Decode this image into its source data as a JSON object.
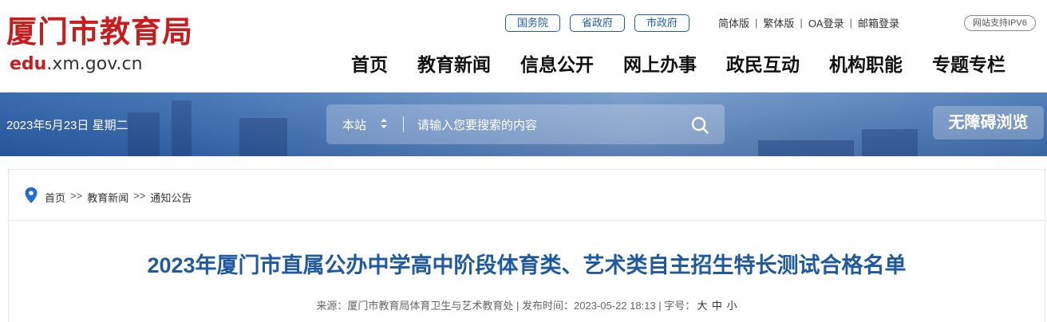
{
  "header": {
    "logo_cn": "厦门市教育局",
    "logo_en_edu": "edu",
    "logo_en_rest": ".xm.gov.cn",
    "gov_links": [
      "国务院",
      "省政府",
      "市政府"
    ],
    "util_links": [
      "简体版",
      "繁体版",
      "OA登录",
      "邮箱登录"
    ],
    "ipv6_badge": "网站支持IPV6",
    "nav": [
      "首页",
      "教育新闻",
      "信息公开",
      "网上办事",
      "政民互动",
      "机构职能",
      "专题专栏"
    ]
  },
  "banner": {
    "date": "2023年5月23日 星期二",
    "search_scope": "本站",
    "search_placeholder": "请输入您要搜索的内容",
    "accessibility_button": "无障碍浏览"
  },
  "breadcrumb": {
    "items": [
      "首页",
      "教育新闻",
      "通知公告"
    ],
    "separator": ">>"
  },
  "article": {
    "title": "2023年厦门市直属公办中学高中阶段体育类、艺术类自主招生特长测试合格名单",
    "source_label": "来源：",
    "source": "厦门市教育局体育卫生与艺术教育处",
    "date_label": "发布时间：",
    "date": "2023-05-22 18:13",
    "font_label": "字号：",
    "font_sizes": [
      "大",
      "中",
      "小"
    ]
  },
  "colors": {
    "brand_red": "#c81d1d",
    "brand_blue": "#1f5aa0",
    "banner_blue": "#3d6fb3"
  }
}
